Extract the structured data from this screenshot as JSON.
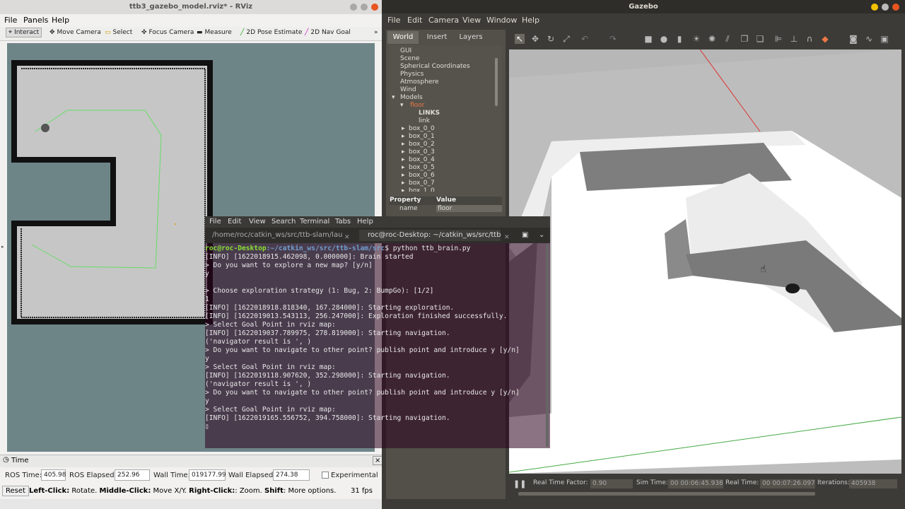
{
  "rviz": {
    "window_title": "ttb3_gazebo_model.rviz* - RViz",
    "menu": [
      "File",
      "Panels",
      "Help"
    ],
    "tools": [
      {
        "label": "Interact",
        "icon": "cursor-icon"
      },
      {
        "label": "Move Camera",
        "icon": "move-camera-icon"
      },
      {
        "label": "Select",
        "icon": "select-icon"
      },
      {
        "label": "Focus Camera",
        "icon": "focus-camera-icon"
      },
      {
        "label": "Measure",
        "icon": "measure-icon"
      },
      {
        "label": "2D Pose Estimate",
        "icon": "pose-estimate-icon"
      },
      {
        "label": "2D Nav Goal",
        "icon": "nav-goal-icon"
      }
    ],
    "time_panel_title": "Time",
    "ros_time_label": "ROS Time:",
    "ros_time": "405.98",
    "ros_elapsed_label": "ROS Elapsed:",
    "ros_elapsed": "252.96",
    "wall_time_label": "Wall Time:",
    "wall_time": "019177.99",
    "wall_elapsed_label": "Wall Elapsed:",
    "wall_elapsed": "274.38",
    "experimental_label": "Experimental",
    "reset_label": "Reset",
    "hint_bold1": "Left-Click:",
    "hint1": " Rotate. ",
    "hint_bold2": "Middle-Click:",
    "hint2": " Move X/Y. ",
    "hint_bold3": "Right-Click:",
    "hint3": ": Zoom. ",
    "hint_bold4": "Shift",
    "hint4": ": More options.",
    "fps": "31 fps"
  },
  "gazebo": {
    "window_title": "Gazebo",
    "menu": [
      "File",
      "Edit",
      "Camera",
      "View",
      "Window",
      "Help"
    ],
    "tabs": [
      "World",
      "Insert",
      "Layers"
    ],
    "tree": {
      "items": [
        "GUI",
        "Scene",
        "Spherical Coordinates",
        "Physics",
        "Atmosphere",
        "Wind",
        "Models"
      ],
      "model_name": "floor",
      "links_label": "LINKS",
      "link": "link",
      "boxes": [
        "box_0_0",
        "box_0_1",
        "box_0_2",
        "box_0_3",
        "box_0_4",
        "box_0_5",
        "box_0_6",
        "box_0_7",
        "box_1_0"
      ]
    },
    "property_header": "Property",
    "value_header": "Value",
    "prop_name": "name",
    "prop_value": "floor",
    "bottom": {
      "rtf_label": "Real Time Factor:",
      "rtf": "0.90",
      "sim_label": "Sim Time:",
      "sim": "00 00:06:45.938",
      "real_label": "Real Time:",
      "real": "00 00:07:26.097",
      "iter_label": "Iterations:",
      "iter": "405938"
    }
  },
  "terminal": {
    "menu": [
      "File",
      "Edit",
      "View",
      "Search",
      "Terminal",
      "Tabs",
      "Help"
    ],
    "tab1": "/home/roc/catkin_ws/src/ttb-slam/lau...",
    "tab2": "roc@roc-Desktop: ~/catkin_ws/src/ttb-...",
    "prompt_user": "roc@roc-Desktop",
    "prompt_path": ":~/catkin_ws/src/ttb-slam/src",
    "prompt_cmd": "$ python ttb_brain.py",
    "lines": [
      "[INFO] [1622018915.462098, 0.000000]: Brain started",
      "> Do you want to explore a new map? [y/n]",
      "y",
      "",
      "> Choose exploration strategy (1: Bug, 2: BumpGo): [1/2]",
      "1",
      "[INFO] [1622018918.818340, 167.284000]: Starting exploration.",
      "[INFO] [1622019013.543113, 256.247000]: Exploration finished successfully.",
      "> Select Goal Point in rviz map:",
      "[INFO] [1622019037.789975, 278.819000]: Starting navigation.",
      "('navigator result is ', )",
      "> Do you want to navigate to other point? publish point and introduce y [y/n]",
      "y",
      "> Select Goal Point in rviz map:",
      "[INFO] [1622019118.907620, 352.298000]: Starting navigation.",
      "('navigator result is ', )",
      "> Do you want to navigate to other point? publish point and introduce y [y/n]",
      "y",
      "> Select Goal Point in rviz map:",
      "[INFO] [1622019165.556752, 394.758000]: Starting navigation."
    ]
  }
}
